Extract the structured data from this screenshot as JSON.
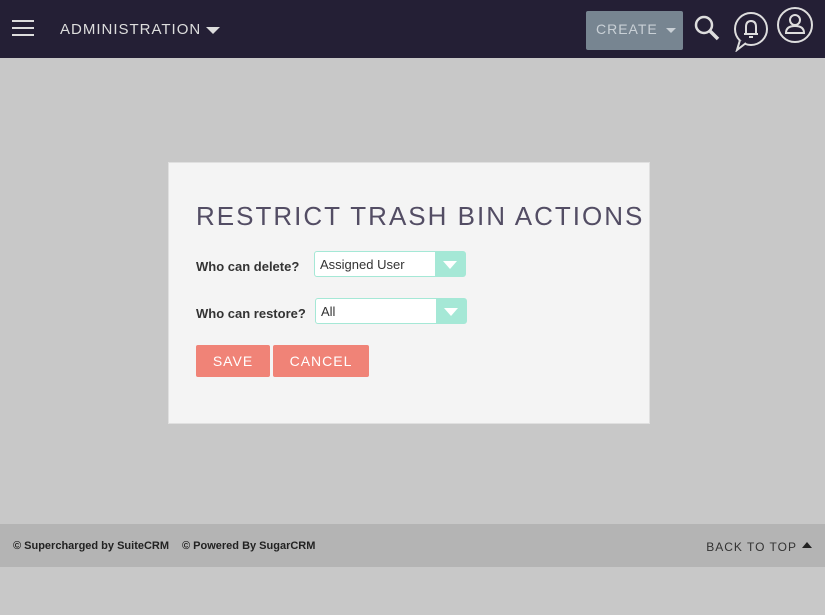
{
  "nav": {
    "menu_icon": "hamburger-icon",
    "module": "ADMINISTRATION",
    "create": "CREATE",
    "icons": [
      "search-icon",
      "notification-bell-icon",
      "user-profile-icon"
    ]
  },
  "dialog": {
    "title": "RESTRICT TRASH BIN ACTIONS",
    "delete_label": "Who can delete?",
    "delete_value": "Assigned User",
    "restore_label": "Who can restore?",
    "restore_value": "All",
    "save": "SAVE",
    "cancel": "CANCEL",
    "accent": "#a5e8d6",
    "button_color": "#f08377"
  },
  "footer": {
    "suitecrm": "© Supercharged by SuiteCRM",
    "sugarcrm": "© Powered By SugarCRM",
    "back_to_top": "BACK TO TOP"
  }
}
